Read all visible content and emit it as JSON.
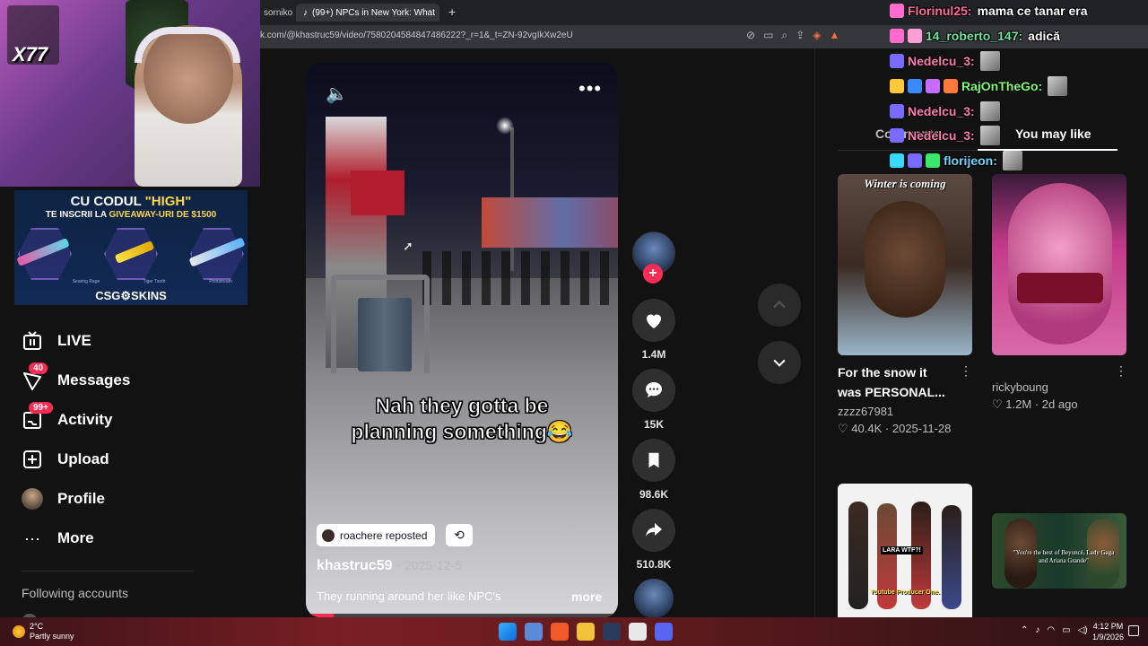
{
  "browser": {
    "tabs": [
      {
        "label": "sornikoj"
      },
      {
        "label": "(99+) NPCs in New York: What",
        "close": "✕"
      }
    ],
    "new_tab": "+",
    "url": "k.com/@khastruc59/video/7580204584847486222?_r=1&_t=ZN-92vgIkXw2eU"
  },
  "webcam": {
    "multiplier": "X77"
  },
  "promo": {
    "line1_pre": "CU CODUL ",
    "line1_code": "\"HIGH\"",
    "line2_pre": "TE INSCRII LA ",
    "line2_hl": "GIVEAWAY-URI DE $1500",
    "skins": [
      "Searing Rage",
      "Tiger Tooth",
      "Printstream"
    ],
    "logo": "CSG⚙SKINS"
  },
  "sidebar": {
    "items": [
      {
        "label": "LIVE"
      },
      {
        "label": "Messages",
        "badge": "40"
      },
      {
        "label": "Activity",
        "badge": "99+"
      },
      {
        "label": "Upload"
      },
      {
        "label": "Profile"
      },
      {
        "label": "More"
      }
    ],
    "following_title": "Following accounts"
  },
  "video": {
    "caption_line1": "Nah they gotta be",
    "caption_line2": "planning something😂",
    "repost_label": "roachere reposted",
    "author": "khastruc59",
    "separator": "·",
    "date": "2025-12-5",
    "description": "They running around her like NPC's",
    "more_label": "more",
    "progress": 0.09
  },
  "actions": {
    "likes": "1.4M",
    "comments": "15K",
    "saves": "98.6K",
    "shares": "510.8K"
  },
  "panel": {
    "tab_comments": "Comments",
    "tab_like": "You may like",
    "cards": [
      {
        "thumb_text": "Winter is coming",
        "title_l1": "For the snow it",
        "title_l2": "was PERSONAL...",
        "author": "zzzz67981",
        "likes": "40.4K",
        "date": "2025-11-28"
      },
      {
        "thumb_text": "",
        "title_l1": "",
        "title_l2": "",
        "author": "rickyboung",
        "likes": "1.2M",
        "date": "2d ago"
      },
      {
        "thumb_text": "LARA WTF?!",
        "caption": "Youtube Producer One."
      },
      {
        "thumb_text": "\"You're the best of Beyoncé, Lady Gaga and Ariana Grande\""
      }
    ]
  },
  "chat": [
    {
      "user": "Florinul25:",
      "msg": "mama ce tanar era",
      "color": "#ff6b9a"
    },
    {
      "user": "14_roberto_147:",
      "msg": "adică",
      "color": "#6fe3a0"
    },
    {
      "user": "Nedelcu_3:",
      "msg": "",
      "color": "#ff7bb0"
    },
    {
      "user": "RajOnTheGo:",
      "msg": "",
      "color": "#7dff6e"
    },
    {
      "user": "Nedelcu_3:",
      "msg": "",
      "color": "#ff7bb0"
    },
    {
      "user": "Nedelcu_3:",
      "msg": "",
      "color": "#ff7bb0"
    },
    {
      "user": "florijeon:",
      "msg": "",
      "color": "#6ed6ff"
    }
  ],
  "taskbar": {
    "temp": "2°C",
    "weather": "Partly sunny",
    "time": "4:12 PM",
    "date": "1/9/2026"
  },
  "colors": {
    "accent": "#fe2c55",
    "bg": "#121212"
  }
}
